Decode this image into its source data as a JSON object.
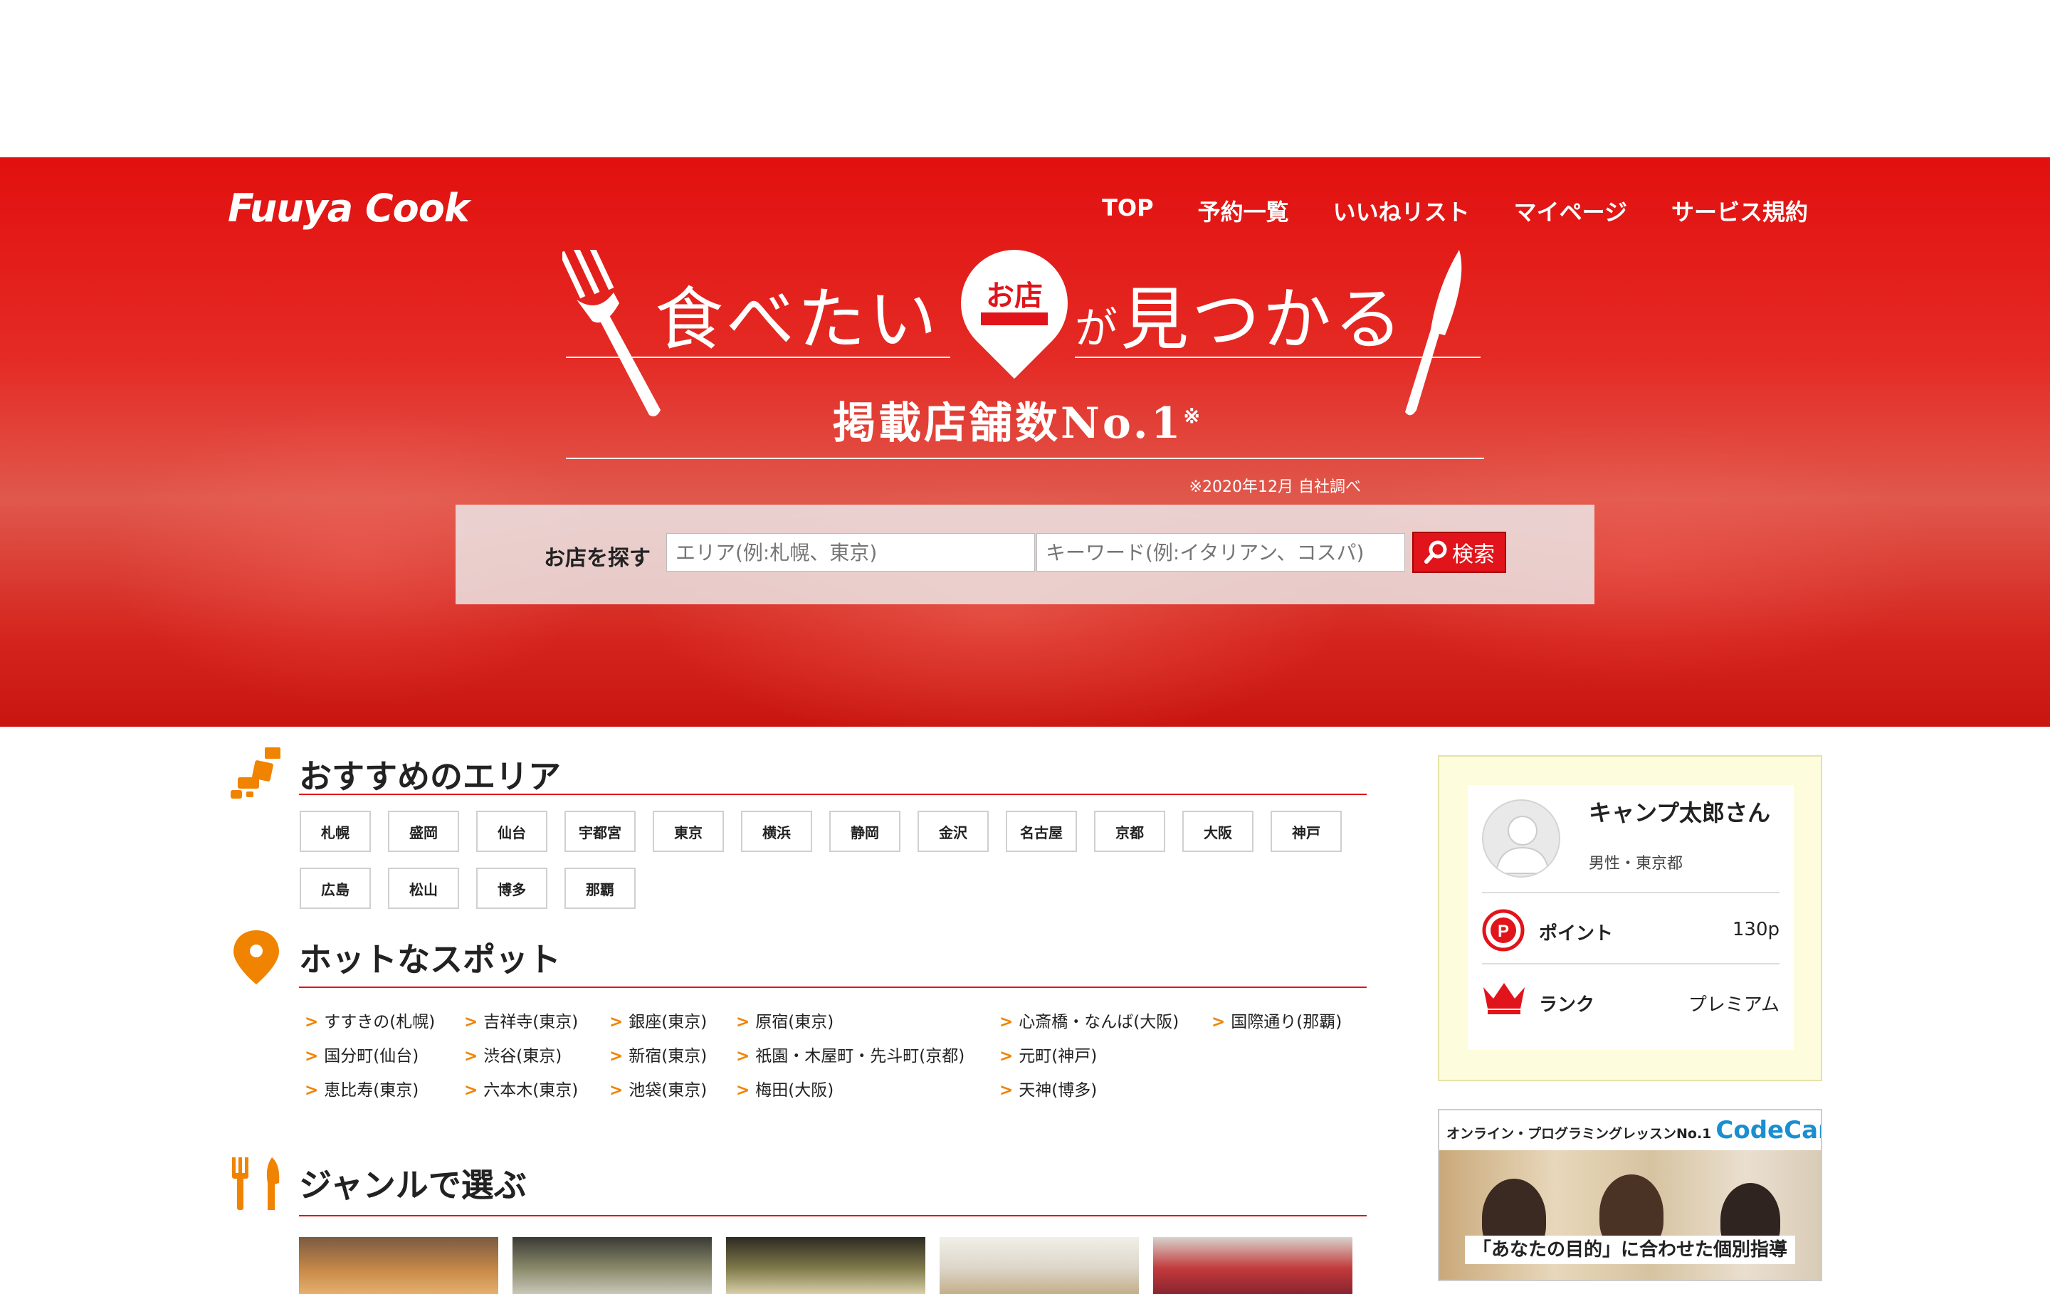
{
  "header": {
    "logo": "Fuuya Cook",
    "nav": [
      "TOP",
      "予約一覧",
      "いいねリスト",
      "マイページ",
      "サービス規約"
    ]
  },
  "hero": {
    "catch_part1": "食べたい",
    "pin_text": "お店",
    "catch_small": "が",
    "catch_part2": "見つかる",
    "sub": "掲載店舗数No.1",
    "sub_mark": "※",
    "note": "※2020年12月 自社調べ"
  },
  "search": {
    "label": "お店を探す",
    "area_placeholder": "エリア(例:札幌、東京)",
    "keyword_placeholder": "キーワード(例:イタリアン、コスパ)",
    "button": "検索"
  },
  "areas": {
    "title": "おすすめのエリア",
    "items": [
      "札幌",
      "盛岡",
      "仙台",
      "宇都宮",
      "東京",
      "横浜",
      "静岡",
      "金沢",
      "名古屋",
      "京都",
      "大阪",
      "神戸",
      "広島",
      "松山",
      "博多",
      "那覇"
    ]
  },
  "spots": {
    "title": "ホットなスポット",
    "items": [
      "すすきの(札幌)",
      "吉祥寺(東京)",
      "銀座(東京)",
      "原宿(東京)",
      "心斎橋・なんば(大阪)",
      "国際通り(那覇)",
      "国分町(仙台)",
      "渋谷(東京)",
      "新宿(東京)",
      "祇園・木屋町・先斗町(京都)",
      "元町(神戸)",
      "恵比寿(東京)",
      "六本木(東京)",
      "池袋(東京)",
      "梅田(大阪)",
      "天神(博多)"
    ]
  },
  "genres": {
    "title": "ジャンルで選ぶ"
  },
  "user": {
    "name": "キャンプ太郎さん",
    "info": "男性・東京都",
    "point_label": "ポイント",
    "point_value": "130p",
    "rank_label": "ランク",
    "rank_value": "プレミアム"
  },
  "ad": {
    "top": "オンライン・プログラミングレッスンNo.1",
    "brand": "CodeCamp",
    "banner": "「あなたの目的」に合わせた個別指導"
  },
  "colors": {
    "brand_red": "#e0141a",
    "accent_orange": "#f08300"
  }
}
